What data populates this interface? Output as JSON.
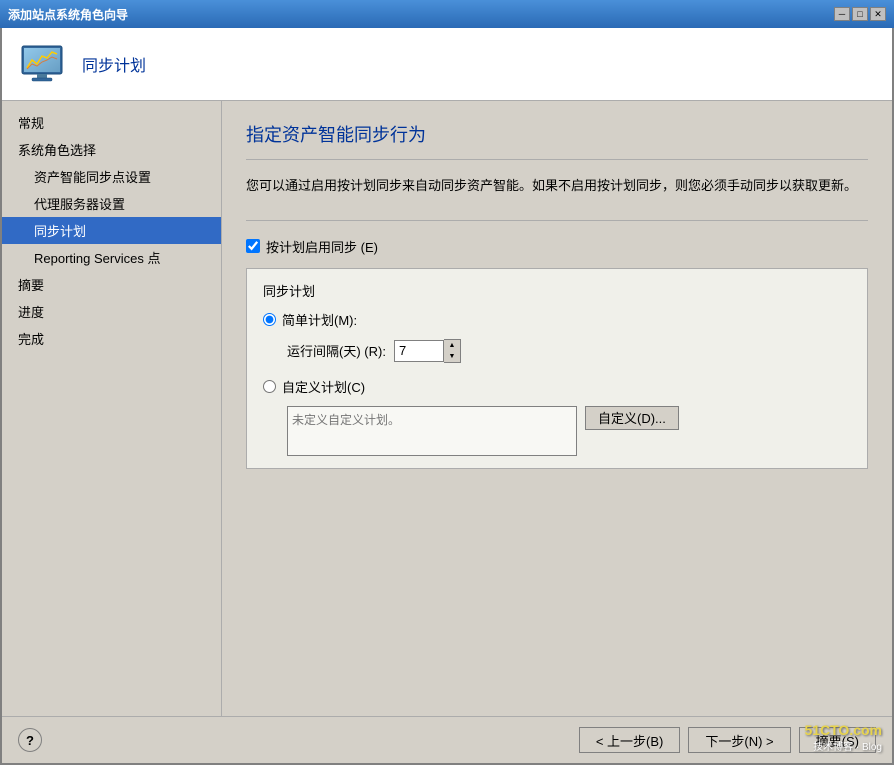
{
  "titleBar": {
    "text": "添加站点系统角色向导",
    "closeBtn": "✕",
    "minBtn": "─",
    "maxBtn": "□"
  },
  "header": {
    "title": "同步计划"
  },
  "sidebar": {
    "items": [
      {
        "id": "general",
        "label": "常规",
        "indent": 0,
        "active": false
      },
      {
        "id": "role-select",
        "label": "系统角色选择",
        "indent": 0,
        "active": false
      },
      {
        "id": "asset-sync",
        "label": "资产智能同步点设置",
        "indent": 1,
        "active": false
      },
      {
        "id": "proxy",
        "label": "代理服务器设置",
        "indent": 1,
        "active": false
      },
      {
        "id": "sync-plan",
        "label": "同步计划",
        "indent": 1,
        "active": true
      },
      {
        "id": "reporting",
        "label": "Reporting Services 点",
        "indent": 1,
        "active": false
      },
      {
        "id": "summary",
        "label": "摘要",
        "indent": 0,
        "active": false
      },
      {
        "id": "progress",
        "label": "进度",
        "indent": 0,
        "active": false
      },
      {
        "id": "complete",
        "label": "完成",
        "indent": 0,
        "active": false
      }
    ]
  },
  "main": {
    "pageTitle": "指定资产智能同步行为",
    "description": "您可以通过启用按计划同步来自动同步资产智能。如果不启用按计划同步，则您必须手动同步以获取更新。",
    "checkboxLabel": "按计划启用同步 (E)",
    "checkboxChecked": true,
    "scheduleGroupLabel": "同步计划",
    "simpleRadioLabel": "简单计划(M):",
    "simpleSelected": true,
    "intervalLabel": "运行间隔(天) (R):",
    "intervalValue": "7",
    "customRadioLabel": "自定义计划(C)",
    "customSelected": false,
    "customPlaceholder": "未定义自定义计划。",
    "customBtnLabel": "自定义(D)..."
  },
  "footer": {
    "helpLabel": "?",
    "backBtn": "< 上一步(B)",
    "nextBtn": "下一步(N) >",
    "summaryBtn": "摘要(S)"
  },
  "watermark": {
    "site": "51CTO.com",
    "sub": "技术博客 · Blog"
  }
}
